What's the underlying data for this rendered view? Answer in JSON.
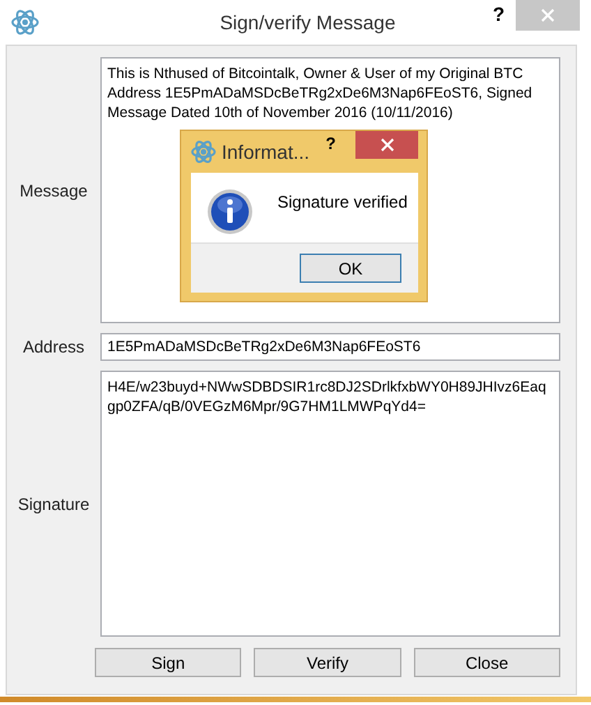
{
  "window": {
    "title": "Sign/verify Message",
    "help": "?"
  },
  "fields": [
    {
      "label": "Message",
      "value": "This is Nthused of Bitcointalk, Owner & User of my Original BTC Address 1E5PmADaMSDcBeTRg2xDe6M3Nap6FEoST6, Signed Message Dated 10th of November 2016 (10/11/2016)",
      "kind": "multiline"
    },
    {
      "label": "Address",
      "value": "1E5PmADaMSDcBeTRg2xDe6M3Nap6FEoST6",
      "kind": "line"
    },
    {
      "label": "Signature",
      "value": "H4E/w23buyd+NWwSDBDSIR1rc8DJ2SDrlkfxbWY0H89JHIvz6Eaqgp0ZFA/qB/0VEGzM6Mpr/9G7HM1LMWPqYd4=",
      "kind": "multiline"
    }
  ],
  "buttons": [
    "Sign",
    "Verify",
    "Close"
  ],
  "dialog": {
    "title": "Informat...",
    "help": "?",
    "message": "Signature verified",
    "button": "OK"
  }
}
